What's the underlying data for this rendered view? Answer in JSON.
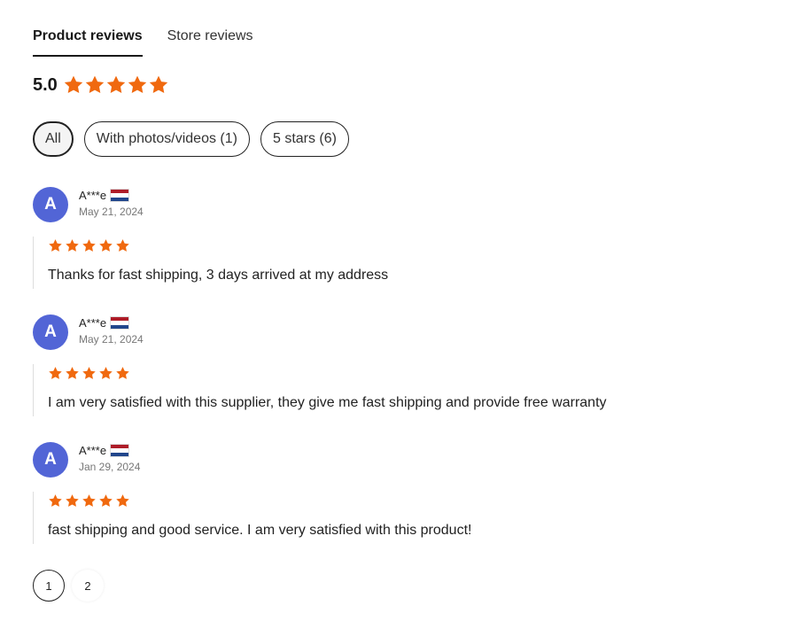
{
  "tabs": [
    {
      "label": "Product reviews",
      "active": true
    },
    {
      "label": "Store reviews",
      "active": false
    }
  ],
  "overall": {
    "score": "5.0",
    "rating": 5,
    "max_rating": 5
  },
  "filters": [
    {
      "label": "All",
      "active": true
    },
    {
      "label": "With photos/videos (1)",
      "active": false
    },
    {
      "label": "5 stars (6)",
      "active": false
    }
  ],
  "reviews": [
    {
      "avatar_letter": "A",
      "name": "A***e",
      "flag_icon": "netherlands-flag-icon",
      "date": "May 21, 2024",
      "rating": 5,
      "text": "Thanks for fast shipping, 3 days arrived at my address"
    },
    {
      "avatar_letter": "A",
      "name": "A***e",
      "flag_icon": "netherlands-flag-icon",
      "date": "May 21, 2024",
      "rating": 5,
      "text": "I am very satisfied with this supplier, they give me fast shipping and provide free warranty"
    },
    {
      "avatar_letter": "A",
      "name": "A***e",
      "flag_icon": "netherlands-flag-icon",
      "date": "Jan 29, 2024",
      "rating": 5,
      "text": "fast shipping and good service. I am very satisfied with this product!"
    }
  ],
  "pagination": {
    "pages": [
      "1",
      "2"
    ],
    "current": "1"
  },
  "colors": {
    "star": "#f0690f",
    "avatar": "#5265d6",
    "flag_red": "#ae1c28",
    "flag_blue": "#21468b"
  }
}
